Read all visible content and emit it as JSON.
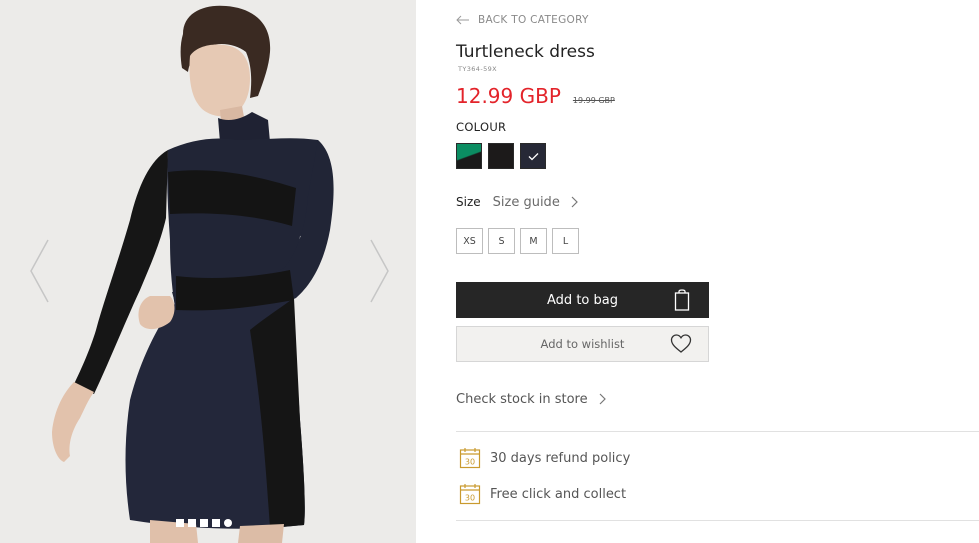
{
  "colors": {
    "accent_price": "#e3232a",
    "button_dark": "#262626",
    "wishlist_bg": "#f2f1ef",
    "icon_gold": "#c99a2e"
  },
  "gallery": {
    "slide_count": 5,
    "active_slide": 5
  },
  "nav": {
    "back_label": "BACK TO CATEGORY"
  },
  "product": {
    "title": "Turtleneck dress",
    "sku": "TY364-59X",
    "price": "12.99 GBP",
    "old_price": "19.99 GBP"
  },
  "colour": {
    "label": "COLOUR",
    "swatches": [
      {
        "name": "green-black",
        "selected": false
      },
      {
        "name": "black",
        "selected": false
      },
      {
        "name": "navy",
        "selected": true
      }
    ]
  },
  "size": {
    "label": "Size",
    "guide_label": "Size guide",
    "options": [
      "XS",
      "S",
      "M",
      "L"
    ]
  },
  "actions": {
    "add_to_bag": "Add to bag",
    "add_to_wishlist": "Add to wishlist",
    "check_stock": "Check stock in store"
  },
  "benefits": [
    {
      "icon": "calendar-30-icon",
      "text": "30 days refund policy"
    },
    {
      "icon": "calendar-30-icon",
      "text": "Free click and collect"
    }
  ],
  "icons": {
    "calendar_number": "30"
  }
}
